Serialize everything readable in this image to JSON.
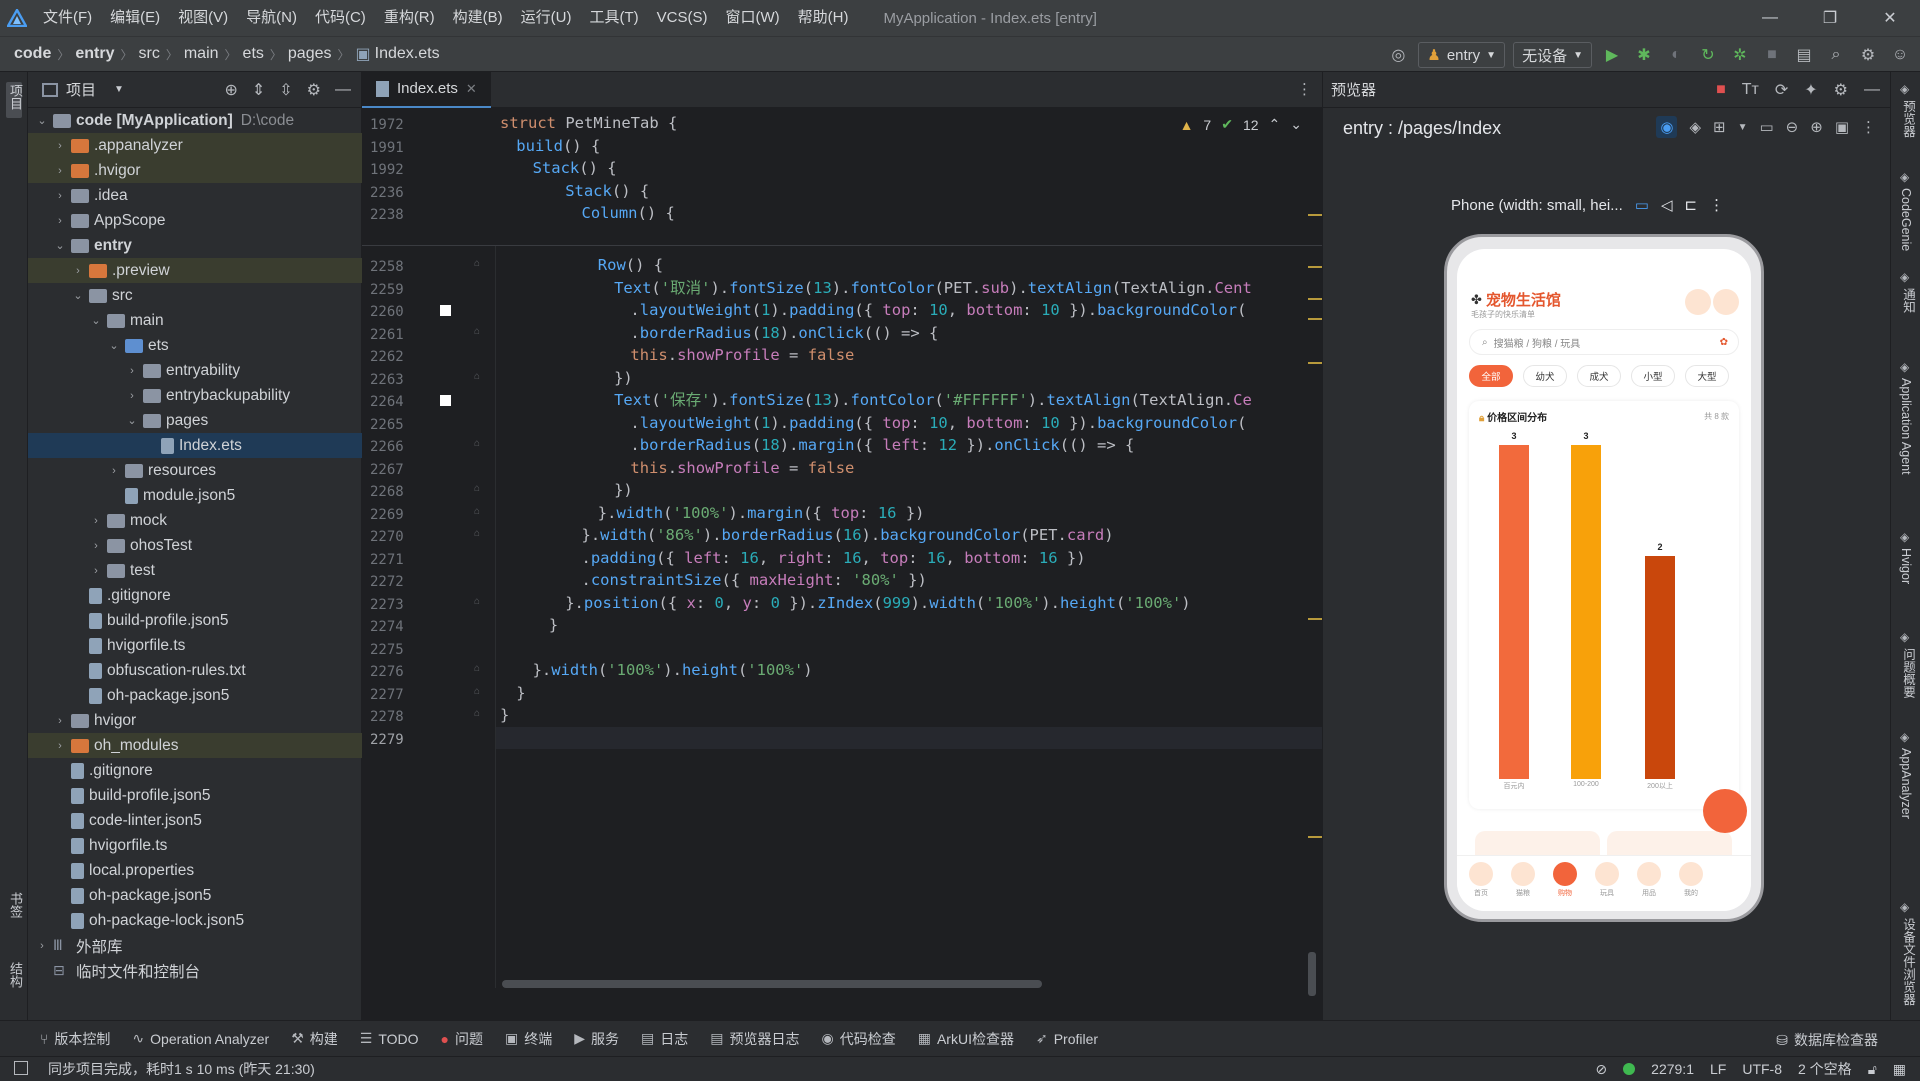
{
  "window": {
    "title": "MyApplication - Index.ets [entry]"
  },
  "menu": [
    "文件(F)",
    "编辑(E)",
    "视图(V)",
    "导航(N)",
    "代码(C)",
    "重构(R)",
    "构建(B)",
    "运行(U)",
    "工具(T)",
    "VCS(S)",
    "窗口(W)",
    "帮助(H)"
  ],
  "breadcrumb": [
    "code",
    "entry",
    "src",
    "main",
    "ets",
    "pages",
    "Index.ets"
  ],
  "toolbar": {
    "run_config": "entry",
    "device": "无设备"
  },
  "left_strip": {
    "project": "项目",
    "bookmarks": "书签",
    "structure": "结构"
  },
  "project_panel": {
    "title": "项目",
    "tree": [
      {
        "label": "code [MyApplication]",
        "hint": "D:\\code",
        "depth": 0,
        "arrow": "v",
        "icon": "folder"
      },
      {
        "label": ".appanalyzer",
        "depth": 1,
        "arrow": ">",
        "icon": "folder-orange",
        "hl": true
      },
      {
        "label": ".hvigor",
        "depth": 1,
        "arrow": ">",
        "icon": "folder-orange",
        "hl": true
      },
      {
        "label": ".idea",
        "depth": 1,
        "arrow": ">",
        "icon": "folder"
      },
      {
        "label": "AppScope",
        "depth": 1,
        "arrow": ">",
        "icon": "folder"
      },
      {
        "label": "entry",
        "depth": 1,
        "arrow": "v",
        "icon": "folder",
        "bold": true
      },
      {
        "label": ".preview",
        "depth": 2,
        "arrow": ">",
        "icon": "folder-orange",
        "hl": true
      },
      {
        "label": "src",
        "depth": 2,
        "arrow": "v",
        "icon": "folder"
      },
      {
        "label": "main",
        "depth": 3,
        "arrow": "v",
        "icon": "folder"
      },
      {
        "label": "ets",
        "depth": 4,
        "arrow": "v",
        "icon": "folder-blue"
      },
      {
        "label": "entryability",
        "depth": 5,
        "arrow": ">",
        "icon": "folder"
      },
      {
        "label": "entrybackupability",
        "depth": 5,
        "arrow": ">",
        "icon": "folder"
      },
      {
        "label": "pages",
        "depth": 5,
        "arrow": "v",
        "icon": "folder"
      },
      {
        "label": "Index.ets",
        "depth": 6,
        "arrow": "",
        "icon": "file",
        "sel": true
      },
      {
        "label": "resources",
        "depth": 4,
        "arrow": ">",
        "icon": "folder"
      },
      {
        "label": "module.json5",
        "depth": 4,
        "arrow": "",
        "icon": "file"
      },
      {
        "label": "mock",
        "depth": 3,
        "arrow": ">",
        "icon": "folder"
      },
      {
        "label": "ohosTest",
        "depth": 3,
        "arrow": ">",
        "icon": "folder"
      },
      {
        "label": "test",
        "depth": 3,
        "arrow": ">",
        "icon": "folder"
      },
      {
        "label": ".gitignore",
        "depth": 2,
        "arrow": "",
        "icon": "file"
      },
      {
        "label": "build-profile.json5",
        "depth": 2,
        "arrow": "",
        "icon": "file"
      },
      {
        "label": "hvigorfile.ts",
        "depth": 2,
        "arrow": "",
        "icon": "file"
      },
      {
        "label": "obfuscation-rules.txt",
        "depth": 2,
        "arrow": "",
        "icon": "file"
      },
      {
        "label": "oh-package.json5",
        "depth": 2,
        "arrow": "",
        "icon": "file"
      },
      {
        "label": "hvigor",
        "depth": 1,
        "arrow": ">",
        "icon": "folder"
      },
      {
        "label": "oh_modules",
        "depth": 1,
        "arrow": ">",
        "icon": "folder-orange",
        "hl": true
      },
      {
        "label": ".gitignore",
        "depth": 1,
        "arrow": "",
        "icon": "file"
      },
      {
        "label": "build-profile.json5",
        "depth": 1,
        "arrow": "",
        "icon": "file"
      },
      {
        "label": "code-linter.json5",
        "depth": 1,
        "arrow": "",
        "icon": "file"
      },
      {
        "label": "hvigorfile.ts",
        "depth": 1,
        "arrow": "",
        "icon": "file"
      },
      {
        "label": "local.properties",
        "depth": 1,
        "arrow": "",
        "icon": "file"
      },
      {
        "label": "oh-package.json5",
        "depth": 1,
        "arrow": "",
        "icon": "file"
      },
      {
        "label": "oh-package-lock.json5",
        "depth": 1,
        "arrow": "",
        "icon": "file"
      },
      {
        "label": "外部库",
        "depth": 0,
        "arrow": ">",
        "icon": "lib"
      },
      {
        "label": "临时文件和控制台",
        "depth": 0,
        "arrow": "",
        "icon": "console"
      }
    ]
  },
  "editor": {
    "tab": "Index.ets",
    "warnings": "7",
    "checks": "12",
    "sticky": [
      {
        "n": "1972",
        "html": "<span class='kw'>struct</span> <span class='cls'>PetMineTab</span> {",
        "indent": 0
      },
      {
        "n": "1991",
        "html": "<span class='fn'>build</span>() {",
        "indent": 1
      },
      {
        "n": "1992",
        "html": "<span class='fn'>Stack</span>() {",
        "indent": 2
      },
      {
        "n": "2236",
        "html": "<span class='fn'>Stack</span>() {",
        "indent": 4
      },
      {
        "n": "2238",
        "html": "<span class='fn'>Column</span>() {",
        "indent": 5
      }
    ],
    "lines": [
      {
        "n": "2258",
        "html": "<span class='fn'>Row</span>() {",
        "indent": 6
      },
      {
        "n": "2259",
        "html": "<span class='fn'>Text</span>(<span class='str'>'取消'</span>).<span class='fn'>fontSize</span>(<span class='num'>13</span>).<span class='fn'>fontColor</span>(PET.<span class='prop'>sub</span>).<span class='fn'>textAlign</span>(TextAlign.<span class='prop'>Cent</span>",
        "indent": 7
      },
      {
        "n": "2260",
        "html": ".<span class='fn'>layoutWeight</span>(<span class='num'>1</span>).<span class='fn'>padding</span>({ <span class='prop'>top</span>: <span class='num'>10</span>, <span class='prop'>bottom</span>: <span class='num'>10</span> }).<span class='fn'>backgroundColor</span>(",
        "indent": 8
      },
      {
        "n": "2261",
        "html": ".<span class='fn'>borderRadius</span>(<span class='num'>18</span>).<span class='fn'>onClick</span>(() => {",
        "indent": 8
      },
      {
        "n": "2262",
        "html": "<span class='kw'>this</span>.<span class='prop'>showProfile</span> = <span class='kw'>false</span>",
        "indent": 8
      },
      {
        "n": "2263",
        "html": "})",
        "indent": 7
      },
      {
        "n": "2264",
        "html": "<span class='fn'>Text</span>(<span class='str'>'保存'</span>).<span class='fn'>fontSize</span>(<span class='num'>13</span>).<span class='fn'>fontColor</span>(<span class='str'>'#FFFFFF'</span>).<span class='fn'>textAlign</span>(TextAlign.<span class='prop'>Ce</span>",
        "indent": 7
      },
      {
        "n": "2265",
        "html": ".<span class='fn'>layoutWeight</span>(<span class='num'>1</span>).<span class='fn'>padding</span>({ <span class='prop'>top</span>: <span class='num'>10</span>, <span class='prop'>bottom</span>: <span class='num'>10</span> }).<span class='fn'>backgroundColor</span>(",
        "indent": 8
      },
      {
        "n": "2266",
        "html": ".<span class='fn'>borderRadius</span>(<span class='num'>18</span>).<span class='fn'>margin</span>({ <span class='prop'>left</span>: <span class='num'>12</span> }).<span class='fn'>onClick</span>(() => {",
        "indent": 8
      },
      {
        "n": "2267",
        "html": "<span class='kw'>this</span>.<span class='prop'>showProfile</span> = <span class='kw'>false</span>",
        "indent": 8
      },
      {
        "n": "2268",
        "html": "})",
        "indent": 7
      },
      {
        "n": "2269",
        "html": "}.<span class='fn'>width</span>(<span class='str'>'100%'</span>).<span class='fn'>margin</span>({ <span class='prop'>top</span>: <span class='num'>16</span> })",
        "indent": 6
      },
      {
        "n": "2270",
        "html": "}.<span class='fn'>width</span>(<span class='str'>'86%'</span>).<span class='fn'>borderRadius</span>(<span class='num'>16</span>).<span class='fn'>backgroundColor</span>(PET.<span class='prop'>card</span>)",
        "indent": 5
      },
      {
        "n": "2271",
        "html": ".<span class='fn'>padding</span>({ <span class='prop'>left</span>: <span class='num'>16</span>, <span class='prop'>right</span>: <span class='num'>16</span>, <span class='prop'>top</span>: <span class='num'>16</span>, <span class='prop'>bottom</span>: <span class='num'>16</span> })",
        "indent": 5
      },
      {
        "n": "2272",
        "html": ".<span class='fn'>constraintSize</span>({ <span class='prop'>maxHeight</span>: <span class='str'>'80%'</span> })",
        "indent": 5
      },
      {
        "n": "2273",
        "html": "}.<span class='fn'>position</span>({ <span class='prop'>x</span>: <span class='num'>0</span>, <span class='prop'>y</span>: <span class='num'>0</span> }).<span class='fn'>zIndex</span>(<span class='num'>999</span>).<span class='fn'>width</span>(<span class='str'>'100%'</span>).<span class='fn'>height</span>(<span class='str'>'100%'</span>)",
        "indent": 4
      },
      {
        "n": "2274",
        "html": "}",
        "indent": 3
      },
      {
        "n": "2275",
        "html": "",
        "indent": 0
      },
      {
        "n": "2276",
        "html": "}.<span class='fn'>width</span>(<span class='str'>'100%'</span>).<span class='fn'>height</span>(<span class='str'>'100%'</span>)",
        "indent": 2
      },
      {
        "n": "2277",
        "html": "}",
        "indent": 1
      },
      {
        "n": "2278",
        "html": "}",
        "indent": 0
      },
      {
        "n": "2279",
        "html": "",
        "indent": 0
      }
    ]
  },
  "preview": {
    "panel_title": "预览器",
    "route": "entry : /pages/Index",
    "device_label": "Phone (width: small, hei...",
    "app": {
      "title": "宠物生活馆",
      "subtitle": "毛孩子的快乐清单",
      "search_placeholder": "搜猫粮 / 狗粮 / 玩具",
      "chips": [
        "全部",
        "幼犬",
        "成犬",
        "小型",
        "大型"
      ],
      "active_chip": 0,
      "card_title": "价格区间分布",
      "card_right": "共 8 款",
      "tabs": [
        "首页",
        "猫粮",
        "购物",
        "玩具",
        "用品",
        "我的"
      ],
      "active_tab": 2
    }
  },
  "chart_data": {
    "type": "bar",
    "title": "价格区间分布",
    "categories": [
      "百元内",
      "100-200",
      "200以上"
    ],
    "values": [
      3,
      3,
      2
    ],
    "colors": [
      "#f26a3c",
      "#f8a10a",
      "#c9470c"
    ],
    "ylim": [
      0,
      3
    ]
  },
  "right_strip": [
    "预览器",
    "CodeGenie",
    "通知",
    "Application Agent",
    "Hvigor",
    "问题概要",
    "AppAnalyzer",
    "设备文件浏览器"
  ],
  "bottom_tools": [
    "版本控制",
    "Operation Analyzer",
    "构建",
    "TODO",
    "问题",
    "终端",
    "服务",
    "日志",
    "预览器日志",
    "代码检查",
    "ArkUI检查器",
    "Profiler"
  ],
  "bottom_right_tool": "数据库检查器",
  "status": {
    "message": "同步项目完成，耗时1 s 10 ms (昨天 21:30)",
    "position": "2279:1",
    "line_ending": "LF",
    "encoding": "UTF-8",
    "indent": "2 个空格"
  }
}
